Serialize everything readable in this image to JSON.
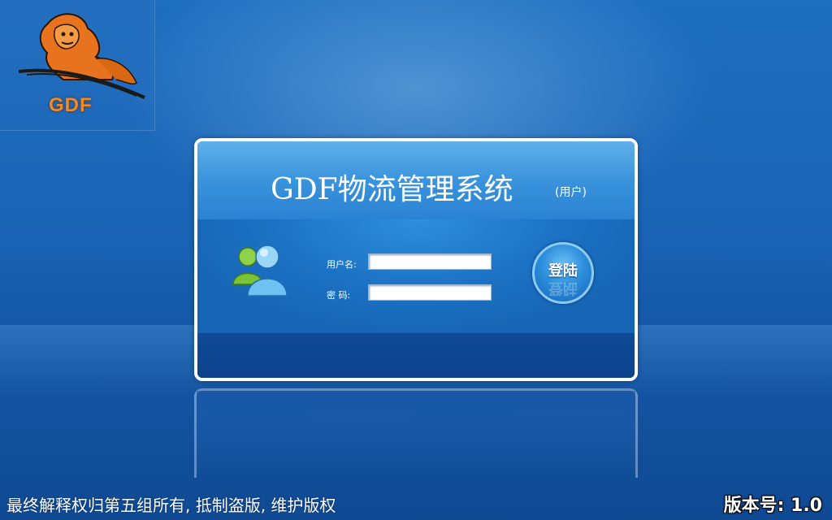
{
  "logo": {
    "text": "GDF",
    "icon": "lion-logo-icon"
  },
  "panel": {
    "title": "GDF物流管理系统",
    "subtitle": "(用户)",
    "username_label": "用户名:",
    "username_value": "",
    "password_label": "密  码:",
    "password_value": "",
    "login_label": "登陆",
    "users_icon": "users-icon"
  },
  "footer": {
    "copyright": "最终解释权归第五组所有, 抵制盗版, 维护版权",
    "version": "版本号: 1.0"
  },
  "colors": {
    "background": "#1a63b4",
    "header": "#3a93dc",
    "logo_orange": "#f08a2a",
    "panel_border": "#ffffff"
  }
}
